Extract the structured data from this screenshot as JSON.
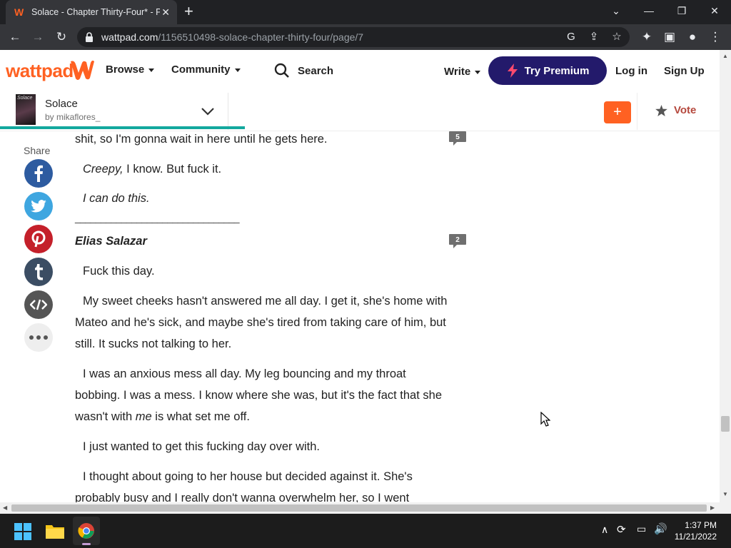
{
  "browser": {
    "tab_title": "Solace - Chapter Thirty-Four* - P",
    "url_host": "wattpad.com",
    "url_path": "/1156510498-solace-chapter-thirty-four/page/7"
  },
  "header": {
    "logo_text": "wattpad",
    "nav": {
      "browse": "Browse",
      "community": "Community",
      "search": "Search",
      "write": "Write"
    },
    "premium_label": "Try Premium",
    "login": "Log in",
    "signup": "Sign Up"
  },
  "story": {
    "cover_text": "Solace",
    "title": "Solace",
    "author": "by mikaflores_",
    "add_label": "+",
    "vote_label": "Vote",
    "progress": 0.34
  },
  "share": {
    "label": "Share"
  },
  "content": {
    "paragraphs": [
      {
        "text": "shit, so I'm gonna wait in here until he gets here.",
        "comments": "5"
      },
      {
        "text": "Creepy, I know. But fuck it."
      },
      {
        "text": "I can do this."
      },
      {
        "text": "________________________________"
      },
      {
        "text": "Elias Salazar",
        "comments": "2"
      },
      {
        "text": "Fuck this day."
      },
      {
        "text": "My sweet cheeks hasn't answered me all day. I get it, she's home with Mateo and he's sick, and maybe she's tired from taking care of him, but still. It sucks not talking to her."
      },
      {
        "text_before": "I was an anxious mess all day. My leg bouncing and my throat bobbing. I was a mess. I know where she was, but it's the fact that she wasn't with ",
        "text_em": "me",
        "text_after": " is what set me off."
      },
      {
        "text": "I just wanted to get this fucking day over with."
      },
      {
        "text": "I thought about going to her house but decided against it. She's probably busy and I really don't wanna overwhelm her, so I went"
      }
    ],
    "italic_lead": "Creepy,",
    "italic_rest": " I know. But fuck it."
  },
  "scrollbar": {
    "vertical_position": 0.86
  },
  "taskbar": {
    "time": "1:37 PM",
    "date": "11/21/2022"
  },
  "colors": {
    "wattpad_orange": "#ff6122",
    "premium_purple": "#231a6b",
    "progress_teal": "#13a89e",
    "vote_red": "#b5483d"
  }
}
